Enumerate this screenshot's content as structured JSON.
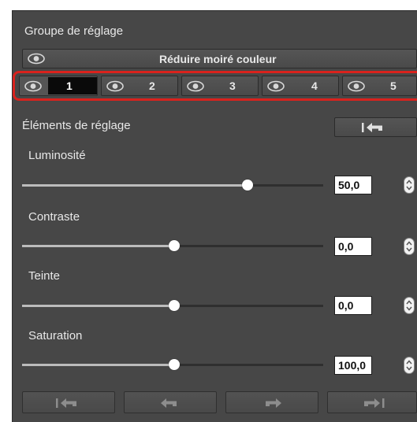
{
  "panel": {
    "title": "Groupe de réglage",
    "filter_label": "Réduire moiré couleur",
    "groups": [
      {
        "label": "1",
        "selected": true
      },
      {
        "label": "2",
        "selected": false
      },
      {
        "label": "3",
        "selected": false
      },
      {
        "label": "4",
        "selected": false
      },
      {
        "label": "5",
        "selected": false
      }
    ],
    "elements_title": "Éléments de réglage",
    "sliders": [
      {
        "label": "Luminosité",
        "value": "50,0",
        "fraction": 0.72
      },
      {
        "label": "Contraste",
        "value": "0,0",
        "fraction": 0.5
      },
      {
        "label": "Teinte",
        "value": "0,0",
        "fraction": 0.5
      },
      {
        "label": "Saturation",
        "value": "100,0",
        "fraction": 0.5
      }
    ],
    "icons": {
      "eye": "eye-icon",
      "reset": "reset-to-start-icon",
      "undo": "undo-arrow-icon",
      "redo": "redo-arrow-icon",
      "to_end": "go-to-end-icon",
      "stepper": "up-down-stepper-icon"
    },
    "colors": {
      "panel_bg": "#474747",
      "highlight_border": "#d9221d",
      "selected_group_bg": "#0a0a0a"
    }
  }
}
